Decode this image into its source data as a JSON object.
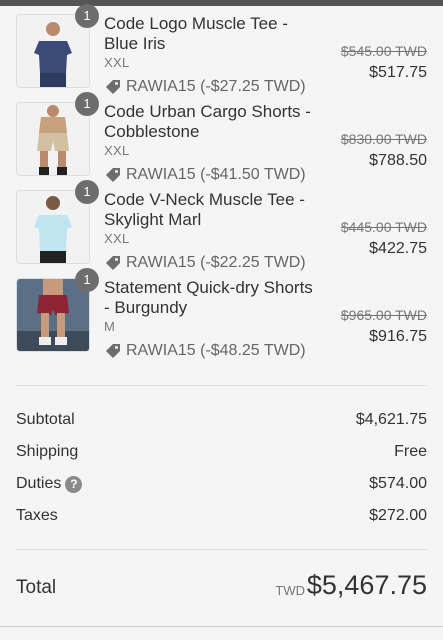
{
  "items": [
    {
      "name": "Code Logo Muscle Tee - Blue Iris",
      "variant": "XXL",
      "qty": "1",
      "discount": "RAWIA15 (-$27.25 TWD)",
      "original": "$545.00 TWD",
      "price": "$517.75",
      "icon": "product-thumbnail"
    },
    {
      "name": "Code Urban Cargo Shorts - Cobblestone",
      "variant": "XXL",
      "qty": "1",
      "discount": "RAWIA15 (-$41.50 TWD)",
      "original": "$830.00 TWD",
      "price": "$788.50",
      "icon": "product-thumbnail"
    },
    {
      "name": "Code V-Neck Muscle Tee - Skylight Marl",
      "variant": "XXL",
      "qty": "1",
      "discount": "RAWIA15 (-$22.25 TWD)",
      "original": "$445.00 TWD",
      "price": "$422.75",
      "icon": "product-thumbnail"
    },
    {
      "name": "Statement Quick-dry Shorts - Burgundy",
      "variant": "M",
      "qty": "1",
      "discount": "RAWIA15 (-$48.25 TWD)",
      "original": "$965.00 TWD",
      "price": "$916.75",
      "icon": "product-thumbnail"
    }
  ],
  "summary": {
    "subtotal_label": "Subtotal",
    "subtotal": "$4,621.75",
    "shipping_label": "Shipping",
    "shipping": "Free",
    "duties_label": "Duties",
    "duties": "$574.00",
    "taxes_label": "Taxes",
    "taxes": "$272.00"
  },
  "total": {
    "label": "Total",
    "currency": "TWD",
    "value": "$5,467.75"
  },
  "colors": {
    "text": "#333333",
    "muted": "#777777",
    "badge": "#6d6d6d",
    "background": "#f5f5f5"
  }
}
